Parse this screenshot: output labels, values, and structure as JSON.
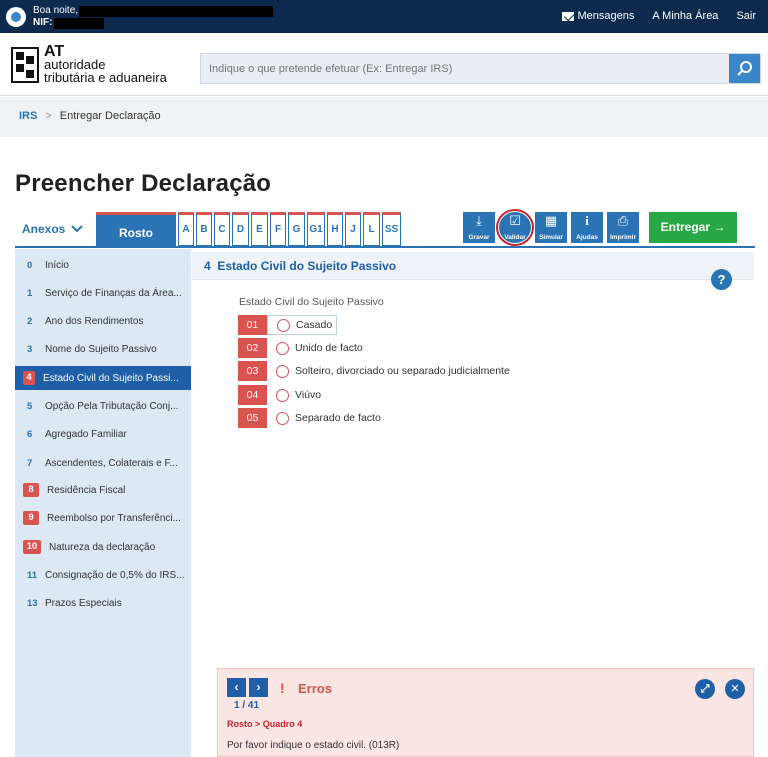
{
  "topbar": {
    "greeting": "Boa noite,",
    "nif_label": "NIF:",
    "nav": [
      "Mensagens",
      "A Minha Área",
      "Sair"
    ]
  },
  "header": {
    "logo_line1": "AT",
    "logo_line2": "autoridade",
    "logo_line3": "tributária e aduaneira",
    "search_placeholder": "Indique o que pretende efetuar (Ex: Entregar IRS)"
  },
  "breadcrumb": {
    "root": "IRS",
    "sep": ">",
    "current": "Entregar Declaração"
  },
  "page_title": "Preencher Declaração",
  "anexos_label": "Anexos",
  "tabs": {
    "active": "Rosto",
    "letters": [
      "A",
      "B",
      "C",
      "D",
      "E",
      "F",
      "G",
      "G1",
      "H",
      "J",
      "L",
      "SS"
    ]
  },
  "toolbar": {
    "gravar": "Gravar",
    "validar": "Validar",
    "simular": "Simular",
    "ajudas": "Ajudas",
    "imprimir": "Imprimir",
    "entregar": "Entregar"
  },
  "sidebar": [
    {
      "num": "0",
      "label": "Início"
    },
    {
      "num": "1",
      "label": "Serviço de Finanças da Área..."
    },
    {
      "num": "2",
      "label": "Ano dos Rendimentos"
    },
    {
      "num": "3",
      "label": "Nome do Sujeito Passivo"
    },
    {
      "num": "4",
      "label": "Estado Civil do Sujeito Passi..."
    },
    {
      "num": "5",
      "label": "Opção Pela Tributação Conj..."
    },
    {
      "num": "6",
      "label": "Agregado Familiar"
    },
    {
      "num": "7",
      "label": "Ascendentes, Colaterais e F..."
    },
    {
      "num": "8",
      "label": "Residência Fiscal"
    },
    {
      "num": "9",
      "label": "Reembolso por Transferênci..."
    },
    {
      "num": "10",
      "label": "Natureza da declaração"
    },
    {
      "num": "11",
      "label": "Consignação de 0,5% do IRS..."
    },
    {
      "num": "13",
      "label": "Prazos Especiais"
    }
  ],
  "section": {
    "num": "4",
    "title": "Estado Civil do Sujeito Passivo",
    "field_label": "Estado Civil do Sujeito Passivo",
    "options": [
      {
        "code": "01",
        "label": "Casado"
      },
      {
        "code": "02",
        "label": "Unido de facto"
      },
      {
        "code": "03",
        "label": "Solteiro, divorciado ou separado judicialmente"
      },
      {
        "code": "04",
        "label": "Viúvo"
      },
      {
        "code": "05",
        "label": "Separado de facto"
      }
    ]
  },
  "errors": {
    "counter": "1 / 41",
    "title": "Erros",
    "path": "Rosto > Quadro 4",
    "message": "Por favor indique o estado civil. (013R)"
  }
}
